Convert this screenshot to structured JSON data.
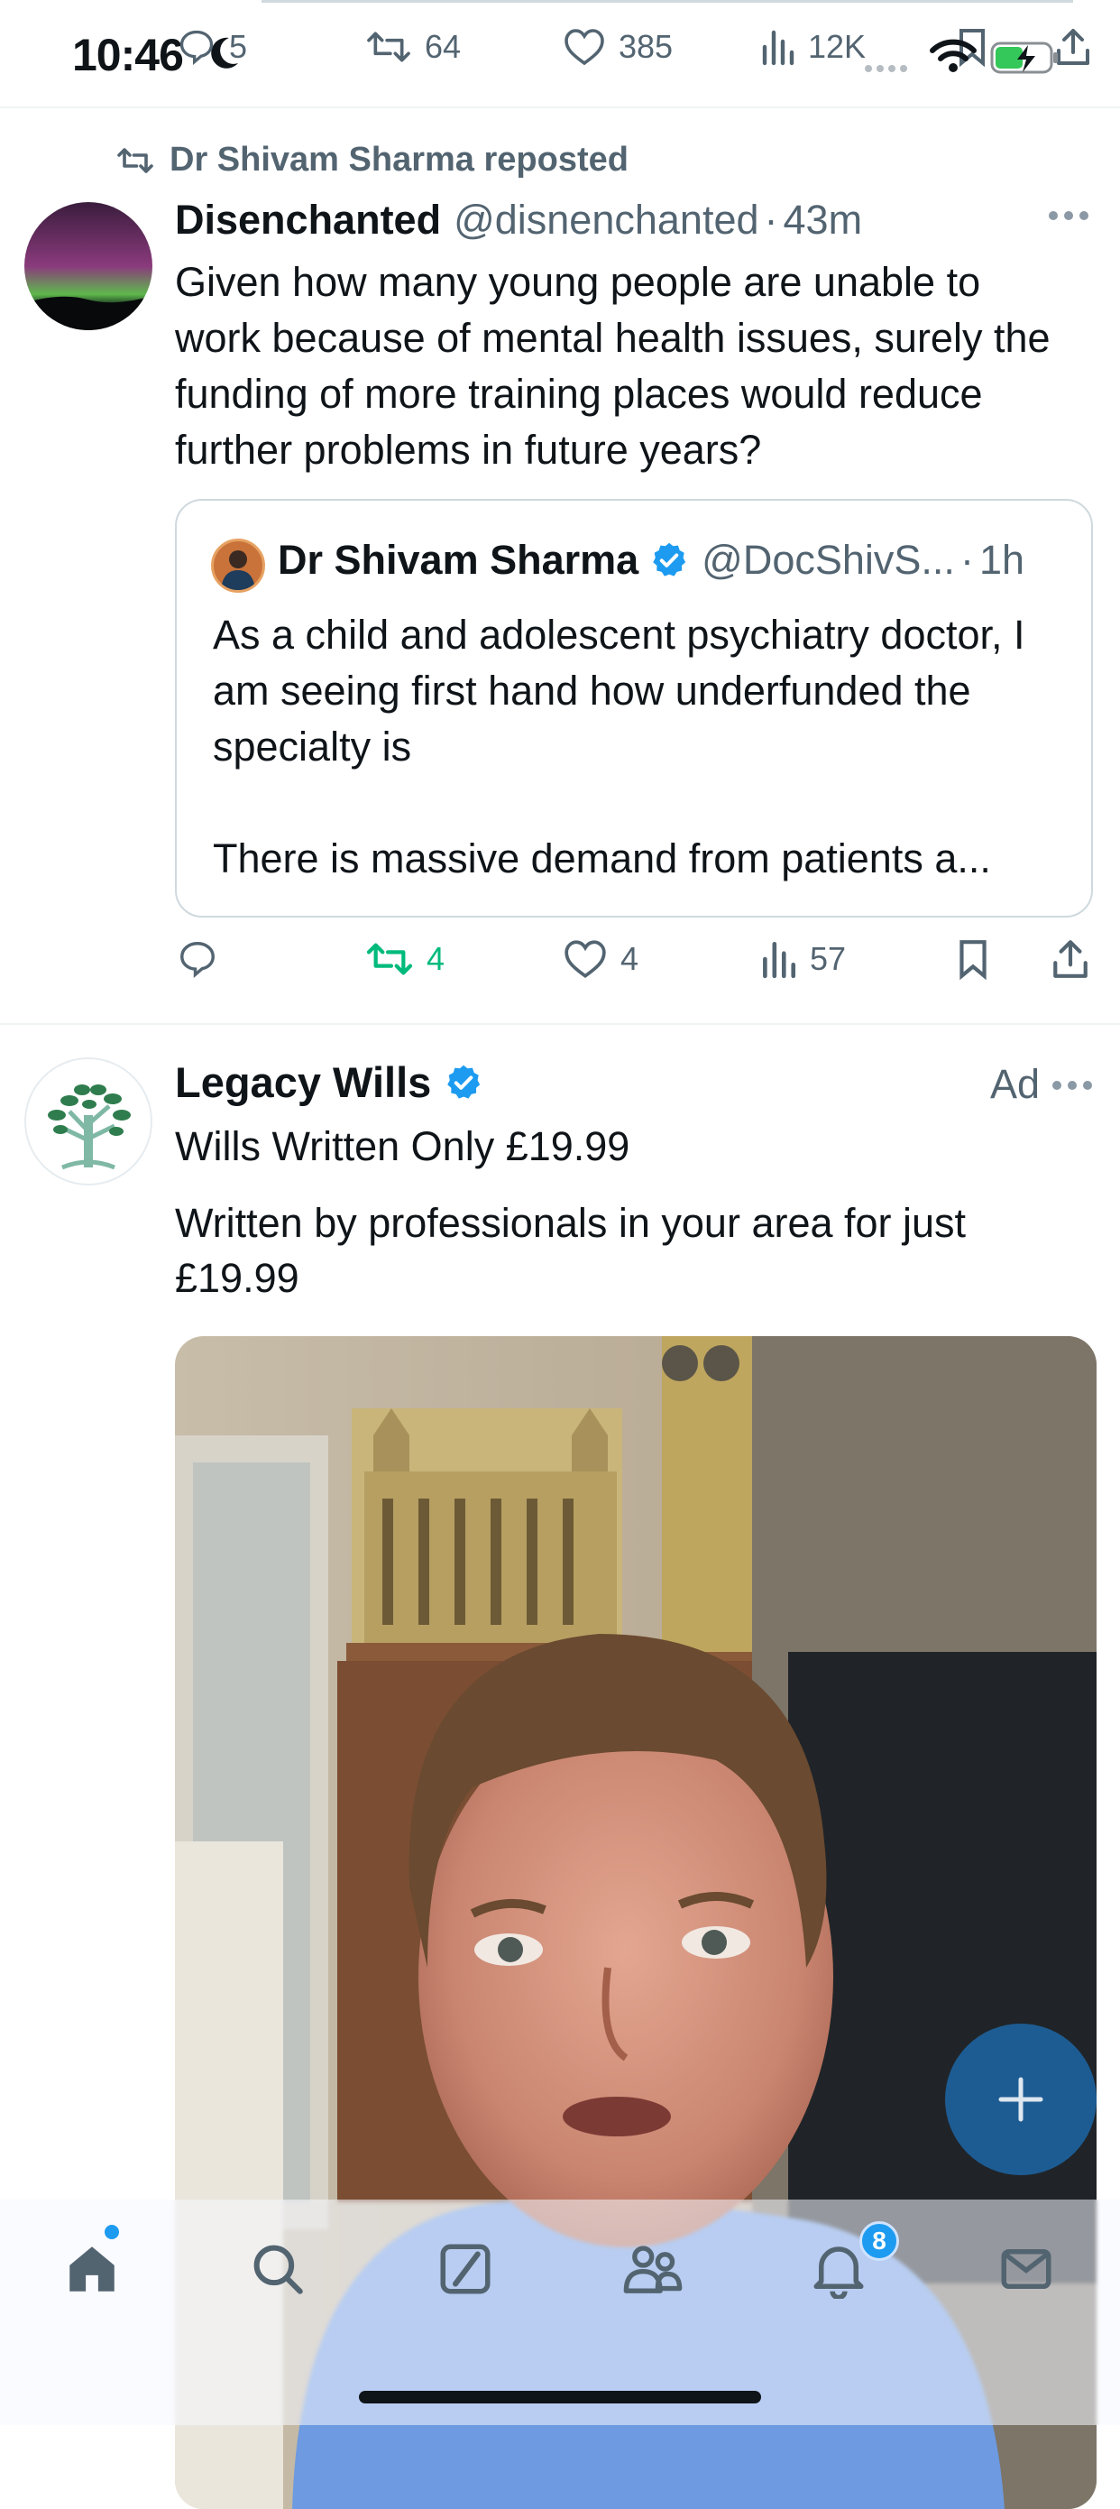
{
  "status_bar": {
    "time": "10:46"
  },
  "top_actions": {
    "replies": "5",
    "reposts": "64",
    "likes": "385",
    "views": "12K"
  },
  "tweet_repost": {
    "repost_label": "Dr Shivam Sharma reposted",
    "author_name": "Disenchanted",
    "author_handle": "@disnenchanted",
    "separator": "·",
    "time": "43m",
    "text": "Given how many young people are unable to work because of mental health issues, surely the funding of more training places would reduce further problems in future years?",
    "quote": {
      "author_name": "Dr Shivam Sharma",
      "author_handle": "@DocShivS...",
      "separator": "·",
      "time": "1h",
      "text_line1": "As a child and adolescent psychiatry doctor, I am seeing first hand how underfunded the specialty is",
      "text_line2": "There is massive demand from patients a..."
    },
    "actions": {
      "replies": "",
      "reposts": "4",
      "likes": "4",
      "views": "57"
    }
  },
  "tweet_ad": {
    "author_name": "Legacy Wills",
    "ad_label": "Ad",
    "headline": "Wills Written Only £19.99",
    "body": "Written by professionals in your area for just £19.99"
  },
  "nav": {
    "notifications_badge": "8"
  },
  "colors": {
    "accent": "#1d9bf0",
    "repost_green": "#00ba7c",
    "muted": "#536471"
  }
}
